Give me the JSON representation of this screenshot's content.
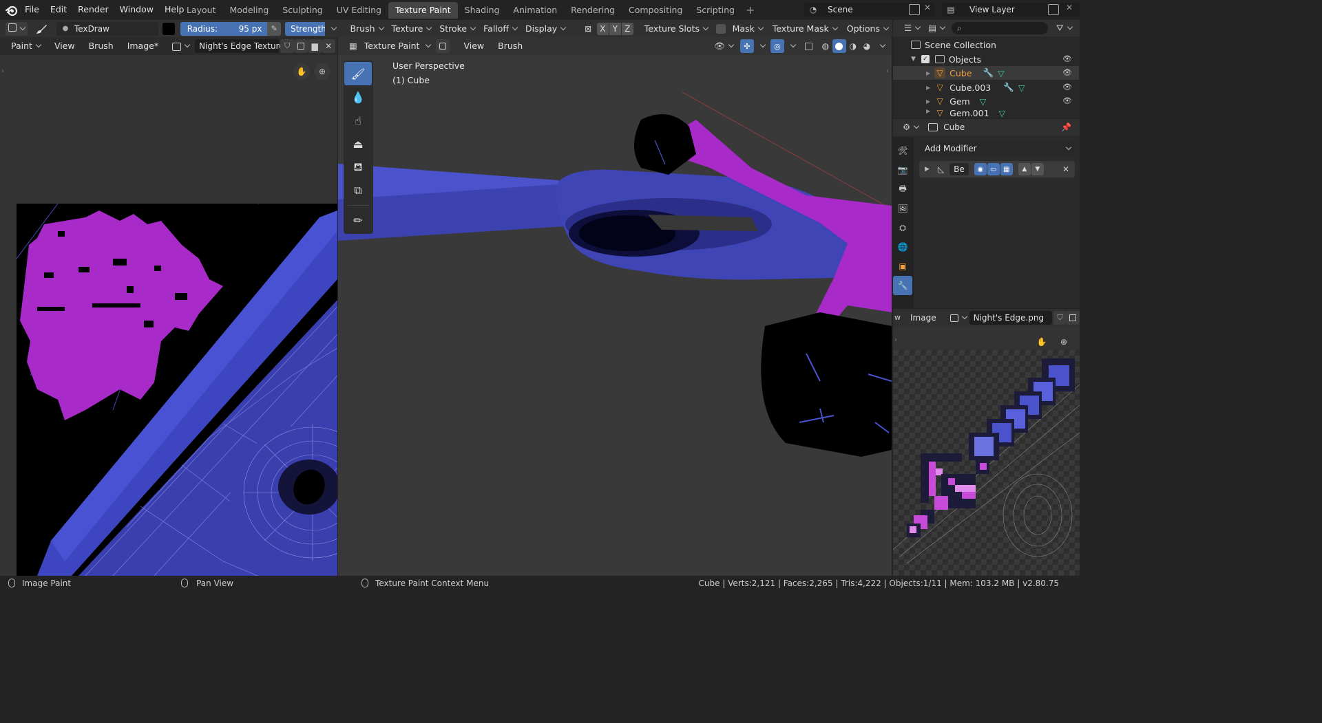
{
  "menu": [
    "File",
    "Edit",
    "Render",
    "Window",
    "Help"
  ],
  "workspaces": [
    "Layout",
    "Modeling",
    "Sculpting",
    "UV Editing",
    "Texture Paint",
    "Shading",
    "Animation",
    "Rendering",
    "Compositing",
    "Scripting"
  ],
  "active_workspace": "Texture Paint",
  "scene": {
    "name": "Scene",
    "view_layer": "View Layer"
  },
  "tool_settings": {
    "brush_name": "TexDraw",
    "radius_label": "Radius:",
    "radius_value": "95 px",
    "strength_label": "Strength:",
    "menus": [
      "Brush",
      "Texture",
      "Stroke",
      "Falloff",
      "Display"
    ],
    "axes": [
      "X",
      "Y",
      "Z"
    ],
    "right_menus": [
      "Texture Slots",
      "Mask",
      "Texture Mask",
      "Options"
    ]
  },
  "image_editor": {
    "mode": "Paint",
    "menus": [
      "View",
      "Brush",
      "Image*"
    ],
    "image_name": "Night's Edge Texture"
  },
  "viewport": {
    "mode": "Texture Paint",
    "menus": [
      "View",
      "Brush"
    ],
    "perspective": "User Perspective",
    "object": "(1) Cube"
  },
  "outliner": {
    "collection": "Scene Collection",
    "items": [
      {
        "name": "Objects"
      },
      {
        "name": "Cube"
      },
      {
        "name": "Cube.003"
      },
      {
        "name": "Gem"
      },
      {
        "name": "Gem.001"
      }
    ]
  },
  "properties": {
    "object": "Cube",
    "add_modifier": "Add Modifier",
    "modifier_name": "Be"
  },
  "image_preview": {
    "label": "Image",
    "image_name": "Night's Edge.png"
  },
  "statusbar": {
    "left": [
      "Image Paint",
      "Pan View",
      "Texture Paint Context Menu"
    ],
    "stats": "Cube | Verts:2,121 | Faces:2,265 | Tris:4,222 | Objects:1/11 | Mem: 103.2 MB | v2.80.75"
  },
  "colors": {
    "accent": "#4772b3",
    "blade_blue": "#4a50c8",
    "hilt_magenta": "#a82ac8",
    "selected_text": "#f0a040"
  }
}
